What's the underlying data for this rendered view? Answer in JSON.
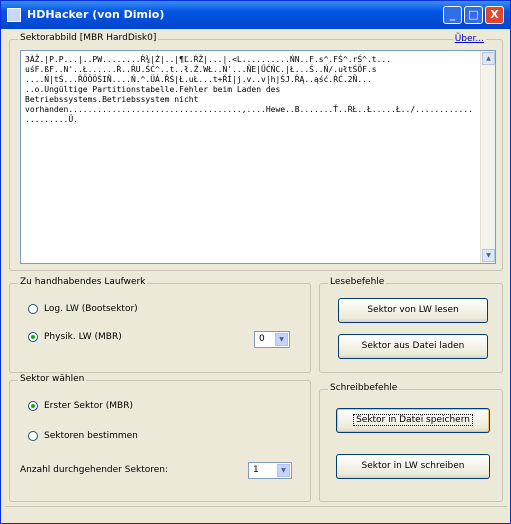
{
  "window": {
    "title": "HDHacker (von Dimio)",
    "minimize_glyph": "_",
    "maximize_glyph": "□",
    "close_glyph": "X"
  },
  "sector_view": {
    "legend": "Sektorabbild [MBR HardDisk0]",
    "link": "Über...",
    "content": "3ÀŽ.|P.P...|..PW........Ŕ¾|Ż|..|¶Ľ.ŔŽ|...|.<L..........ŃN..F.s^.FŚ^.rŚ^.t...\nuśF.ßF..N'..Ł......Ŕ..ŔU.ŚĆ^..t..ł.Ż.WŁ..Ń'...ŇE|ŰĆŃC.|Ł...Ś..Ń/.ułtŚÖF.s\n....Ń|tŚ...ŘÖÖÖŚIÑ....Ń.^.ÜÁ.ŘŚ|Ł.uŁ...t+ŘÍ|j.v..v|h|ŚJ.ŘĄ..ąść.ŔĆ.2Ñ...\n..o.Ungültige Partitionstabelle.Fehler beim Laden des\nBetriebssystems.Betriebssystem nicht\nvorhanden....................................,....Hewe..B.......Ť..ŔŁ..Ł.....Ł../............\n.........Ü.",
    "scroll_up_glyph": "▲",
    "scroll_down_glyph": "▼"
  },
  "drive_group": {
    "legend": "Zu handhabendes Laufwerk",
    "options": [
      {
        "label": "Log. LW (Bootsektor)",
        "selected": false
      },
      {
        "label": "Physik. LW (MBR)",
        "selected": true
      }
    ],
    "drive_value": "0",
    "dropdown_glyph": "▼"
  },
  "read_group": {
    "legend": "Lesebefehle",
    "btn_read_drive": "Sektor von LW lesen",
    "btn_load_file": "Sektor aus Datei laden"
  },
  "sector_group": {
    "legend": "Sektor wählen",
    "options": [
      {
        "label": "Erster Sektor (MBR)",
        "selected": true
      },
      {
        "label": "Sektoren bestimmen",
        "selected": false
      }
    ],
    "count_label": "Anzahl durchgehender Sektoren:",
    "count_value": "1",
    "dropdown_glyph": "▼"
  },
  "write_group": {
    "legend": "Schreibbefehle",
    "btn_save_file": "Sektor in Datei speichern",
    "btn_write_drive": "Sektor in LW schreiben"
  }
}
